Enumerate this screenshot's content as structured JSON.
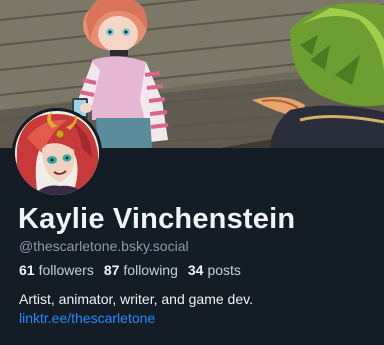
{
  "profile": {
    "display_name": "Kaylie Vinchenstein",
    "handle": "@thescarletone.bsky.social",
    "followers_count": "61",
    "followers_label": "followers",
    "following_count": "87",
    "following_label": "following",
    "posts_count": "34",
    "posts_label": "posts",
    "bio": "Artist, animator, writer, and game dev.",
    "link": "linktr.ee/thescarletone"
  },
  "colors": {
    "background": "#141c26",
    "link": "#208bfe",
    "muted": "#8d9aa8"
  }
}
